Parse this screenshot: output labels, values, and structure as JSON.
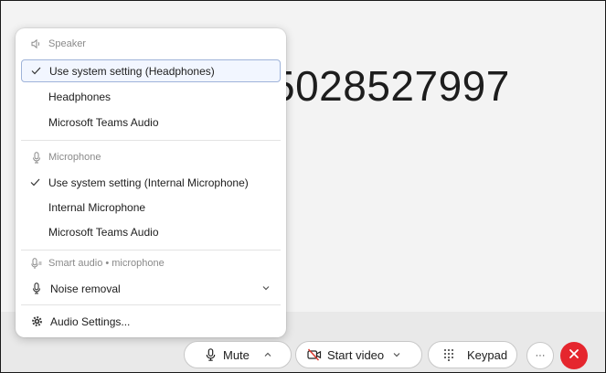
{
  "call": {
    "number_display": "5028527997"
  },
  "menu": {
    "speaker": {
      "header": "Speaker",
      "items": [
        {
          "label": "Use system setting (Headphones)",
          "checked": true
        },
        {
          "label": "Headphones",
          "checked": false
        },
        {
          "label": "Microsoft Teams Audio",
          "checked": false
        }
      ]
    },
    "microphone": {
      "header": "Microphone",
      "items": [
        {
          "label": "Use system setting (Internal Microphone)",
          "checked": true
        },
        {
          "label": "Internal Microphone",
          "checked": false
        },
        {
          "label": "Microsoft Teams Audio",
          "checked": false
        }
      ]
    },
    "smart_audio": {
      "header": "Smart audio • microphone",
      "noise_removal_label": "Noise removal"
    },
    "audio_settings_label": "Audio Settings..."
  },
  "toolbar": {
    "mute_label": "Mute",
    "start_video_label": "Start video",
    "keypad_label": "Keypad",
    "more_label": "···"
  },
  "colors": {
    "end_call": "#e5262e",
    "selected_border": "#9fb3d9",
    "text": "#202020",
    "muted_text": "#8a8a8a"
  }
}
